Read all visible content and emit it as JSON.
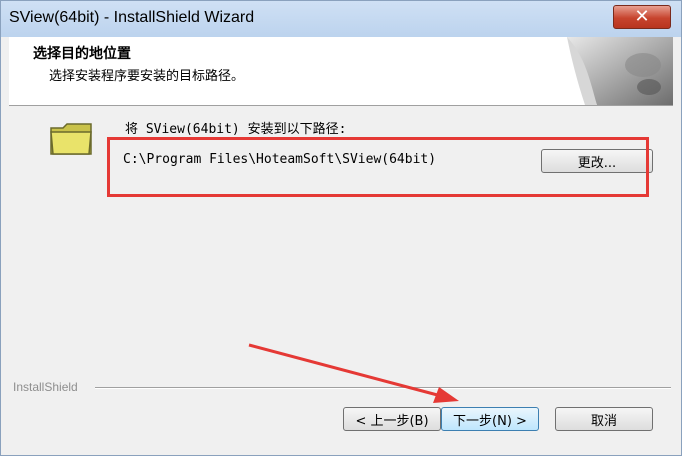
{
  "window": {
    "title": "SView(64bit) - InstallShield Wizard",
    "close_label": "✕"
  },
  "header": {
    "title": "选择目的地位置",
    "subtitle": "选择安装程序要安装的目标路径。"
  },
  "body": {
    "dest_label": "将 SView(64bit) 安装到以下路径:",
    "path": "C:\\Program Files\\HoteamSoft\\SView(64bit)",
    "change_label": "更改..."
  },
  "footer": {
    "brand": "InstallShield",
    "back_label": "< 上一步(B)",
    "next_label": "下一步(N) >",
    "cancel_label": "取消"
  },
  "icons": {
    "folder": "folder-icon",
    "close": "close-icon"
  },
  "colors": {
    "highlight": "#e53935",
    "titlebar": "#c4d8f0",
    "folder": "#e9e36a"
  }
}
